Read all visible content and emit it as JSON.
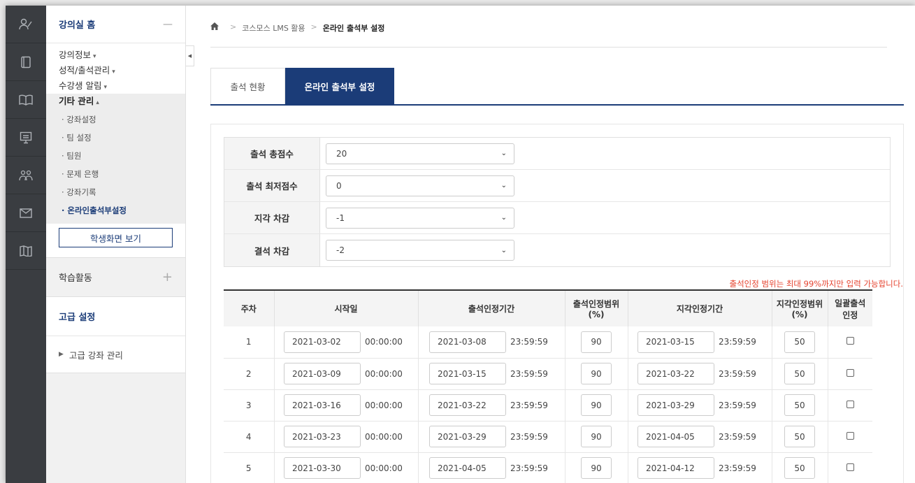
{
  "rail": [
    "user-icon",
    "notebook-icon",
    "book-open-icon",
    "presentation-icon",
    "group-icon",
    "mail-icon",
    "map-icon"
  ],
  "sidebar": {
    "home": "강의실 홈",
    "home_toggle": "—",
    "menu": [
      {
        "label": "강의정보",
        "caret": "▾"
      },
      {
        "label": "성적/출석관리",
        "caret": "▾"
      },
      {
        "label": "수강생 알림",
        "caret": "▾"
      },
      {
        "label": "기타 관리",
        "caret": "▴"
      }
    ],
    "submenu": [
      "· 강좌설정",
      "· 팀 설정",
      "· 팀원",
      "· 문제 은행",
      "· 강좌기록",
      "· 온라인출석부설정"
    ],
    "student_view_button": "학생화면 보기",
    "activity": "학습활동",
    "activity_plus": "+",
    "advanced": "고급 설정",
    "advanced_item": "고급 강좌 관리"
  },
  "breadcrumb": [
    "코스모스 LMS 활용",
    "온라인 출석부 설정"
  ],
  "tabs": [
    "출석 현황",
    "온라인 출석부 설정"
  ],
  "settings": [
    {
      "label": "출석 총점수",
      "value": "20"
    },
    {
      "label": "출석 최저점수",
      "value": "0"
    },
    {
      "label": "지각 차감",
      "value": "-1"
    },
    {
      "label": "결석 차감",
      "value": "-2"
    }
  ],
  "notice": "출석인정 범위는 최대 99%까지만 입력 가능합니다.",
  "table": {
    "headers": [
      "주차",
      "시작일",
      "출석인정기간",
      "출석인정범위\n(%)",
      "지각인정기간",
      "지각인정범위\n(%)",
      "일괄출석\n인정"
    ],
    "rows": [
      {
        "week": "1",
        "start": "2021-03-02",
        "start_time": "00:00:00",
        "att_end": "2021-03-08",
        "att_time": "23:59:59",
        "att_range": "90",
        "late_end": "2021-03-15",
        "late_time": "23:59:59",
        "late_range": "50"
      },
      {
        "week": "2",
        "start": "2021-03-09",
        "start_time": "00:00:00",
        "att_end": "2021-03-15",
        "att_time": "23:59:59",
        "att_range": "90",
        "late_end": "2021-03-22",
        "late_time": "23:59:59",
        "late_range": "50"
      },
      {
        "week": "3",
        "start": "2021-03-16",
        "start_time": "00:00:00",
        "att_end": "2021-03-22",
        "att_time": "23:59:59",
        "att_range": "90",
        "late_end": "2021-03-29",
        "late_time": "23:59:59",
        "late_range": "50"
      },
      {
        "week": "4",
        "start": "2021-03-23",
        "start_time": "00:00:00",
        "att_end": "2021-03-29",
        "att_time": "23:59:59",
        "att_range": "90",
        "late_end": "2021-04-05",
        "late_time": "23:59:59",
        "late_range": "50"
      },
      {
        "week": "5",
        "start": "2021-03-30",
        "start_time": "00:00:00",
        "att_end": "2021-04-05",
        "att_time": "23:59:59",
        "att_range": "90",
        "late_end": "2021-04-12",
        "late_time": "23:59:59",
        "late_range": "50"
      }
    ]
  },
  "colors": {
    "accent": "#1b3c78",
    "warning": "#e5432f",
    "rail": "#3a3d41"
  }
}
